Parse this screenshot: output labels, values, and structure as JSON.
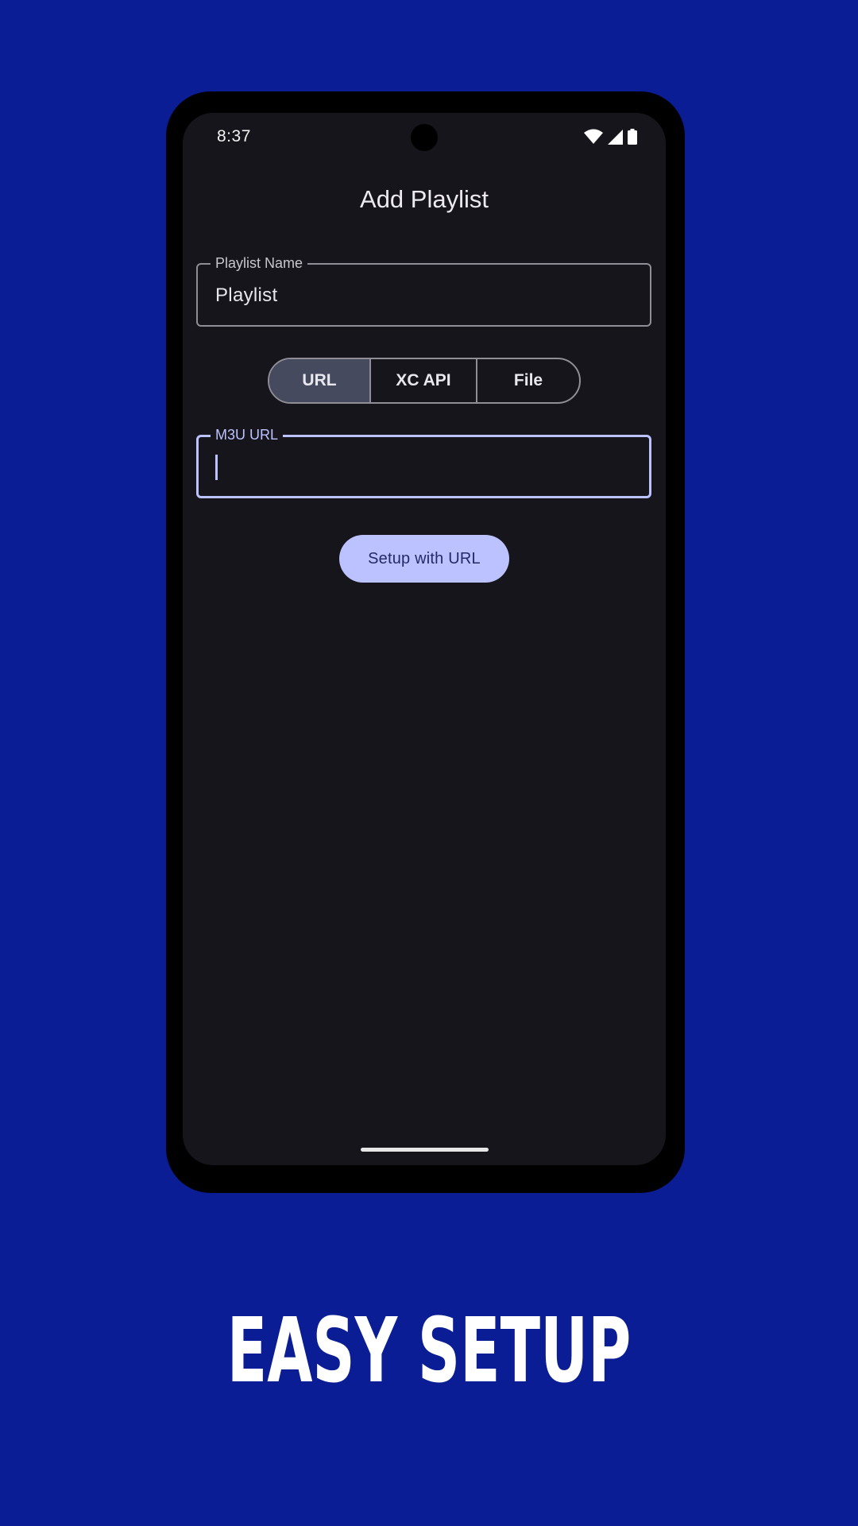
{
  "status_bar": {
    "time": "8:37",
    "icons": [
      "wifi-icon",
      "cell-signal-icon",
      "battery-icon"
    ]
  },
  "header": {
    "title": "Add Playlist"
  },
  "playlist_name_field": {
    "label": "Playlist Name",
    "value": "Playlist"
  },
  "source_tabs": {
    "options": [
      "URL",
      "XC API",
      "File"
    ],
    "selected": "URL"
  },
  "m3u_url_field": {
    "label": "M3U URL",
    "value": ""
  },
  "setup_button": {
    "label": "Setup with URL"
  },
  "tagline": "EASY SETUP",
  "colors": {
    "background": "#0a1d94",
    "screen": "#16151b",
    "accent": "#bcc2ff",
    "selected_segment": "#464a5e",
    "outline": "#8f8e96"
  }
}
